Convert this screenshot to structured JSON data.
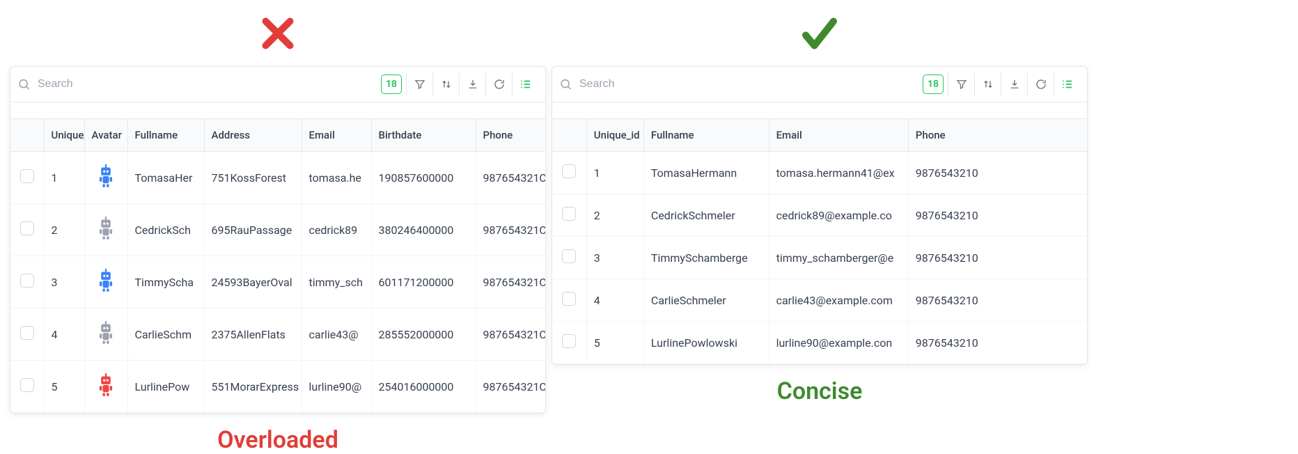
{
  "indicators": {
    "bad_icon": "cross-icon",
    "good_icon": "check-icon"
  },
  "captions": {
    "left": "Overloaded",
    "right": "Concise"
  },
  "search": {
    "placeholder": "Search"
  },
  "count_badge": "18",
  "left_table": {
    "columns": [
      "",
      "Unique_",
      "Avatar",
      "Fullname",
      "Address",
      "Email",
      "Birthdate",
      "Phone"
    ],
    "rows": [
      {
        "id": "1",
        "avatar": "blue",
        "fullname": "TomasaHer",
        "address": "751KossForest",
        "email": "tomasa.he",
        "birthdate": "190857600000",
        "phone": "987654321C"
      },
      {
        "id": "2",
        "avatar": "gray",
        "fullname": "CedrickSch",
        "address": "695RauPassage",
        "email": "cedrick89",
        "birthdate": "380246400000",
        "phone": "987654321C"
      },
      {
        "id": "3",
        "avatar": "blue",
        "fullname": "TimmyScha",
        "address": "24593BayerOval",
        "email": "timmy_sch",
        "birthdate": "601171200000",
        "phone": "987654321C"
      },
      {
        "id": "4",
        "avatar": "gray",
        "fullname": "CarlieSchm",
        "address": "2375AllenFlats",
        "email": "carlie43@",
        "birthdate": "285552000000",
        "phone": "987654321C"
      },
      {
        "id": "5",
        "avatar": "red",
        "fullname": "LurlinePow",
        "address": "551MorarExpress",
        "email": "lurline90@",
        "birthdate": "254016000000",
        "phone": "987654321C"
      }
    ]
  },
  "right_table": {
    "columns": [
      "",
      "Unique_id",
      "Fullname",
      "Email",
      "Phone"
    ],
    "rows": [
      {
        "id": "1",
        "fullname": "TomasaHermann",
        "email": "tomasa.hermann41@ex",
        "phone": "9876543210"
      },
      {
        "id": "2",
        "fullname": "CedrickSchmeler",
        "email": "cedrick89@example.co",
        "phone": "9876543210"
      },
      {
        "id": "3",
        "fullname": "TimmySchamberge",
        "email": "timmy_schamberger@e",
        "phone": "9876543210"
      },
      {
        "id": "4",
        "fullname": "CarlieSchmeler",
        "email": "carlie43@example.com",
        "phone": "9876543210"
      },
      {
        "id": "5",
        "fullname": "LurlinePowlowski",
        "email": "lurline90@example.con",
        "phone": "9876543210"
      }
    ]
  }
}
